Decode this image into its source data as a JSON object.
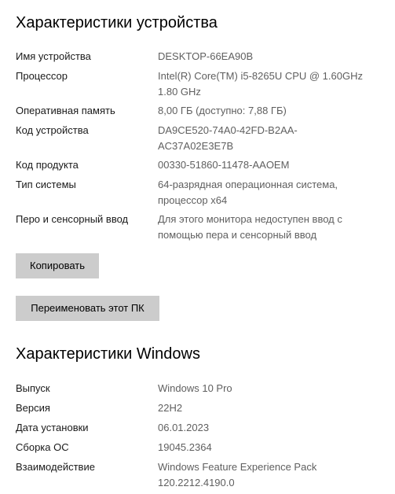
{
  "device_section": {
    "title": "Характеристики устройства",
    "rows": [
      {
        "label": "Имя устройства",
        "value": "DESKTOP-66EA90B"
      },
      {
        "label": "Процессор",
        "value": "Intel(R) Core(TM) i5-8265U CPU @ 1.60GHz\n1.80 GHz"
      },
      {
        "label": "Оперативная память",
        "value": "8,00 ГБ (доступно: 7,88 ГБ)"
      },
      {
        "label": "Код устройства",
        "value": "DA9CE520-74A0-42FD-B2AA-\nAC37A02E3E7B"
      },
      {
        "label": "Код продукта",
        "value": "00330-51860-11478-AAOEM"
      },
      {
        "label": "Тип системы",
        "value": "64-разрядная операционная система,\nпроцессор x64"
      },
      {
        "label": "Перо и сенсорный ввод",
        "value": "Для этого монитора недоступен ввод с\nпомощью пера и сенсорный ввод"
      }
    ],
    "copy_button": "Копировать",
    "rename_button": "Переименовать этот ПК"
  },
  "windows_section": {
    "title": "Характеристики Windows",
    "rows": [
      {
        "label": "Выпуск",
        "value": "Windows 10 Pro"
      },
      {
        "label": "Версия",
        "value": "22H2"
      },
      {
        "label": "Дата установки",
        "value": "06.01.2023"
      },
      {
        "label": "Сборка ОС",
        "value": "19045.2364"
      },
      {
        "label": "Взаимодействие",
        "value": "Windows Feature Experience Pack\n120.2212.4190.0"
      }
    ]
  },
  "colors": {
    "label_text": "#1a1a1a",
    "value_text": "#5f5f5f",
    "button_bg": "#cccccc",
    "background": "#ffffff"
  }
}
